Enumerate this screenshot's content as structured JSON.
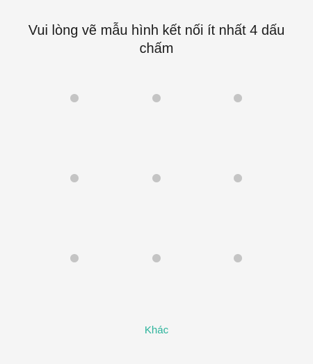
{
  "instruction": {
    "text": "Vui lòng vẽ mẫu hình kết nối ít nhất 4 dấu chấm"
  },
  "pattern": {
    "rows": 3,
    "columns": 3,
    "dot_color": "#c4c4c4"
  },
  "actions": {
    "other_label": "Khác",
    "other_color": "#2bb39b"
  },
  "colors": {
    "background": "#f5f5f5",
    "text": "#1c1c1c"
  }
}
